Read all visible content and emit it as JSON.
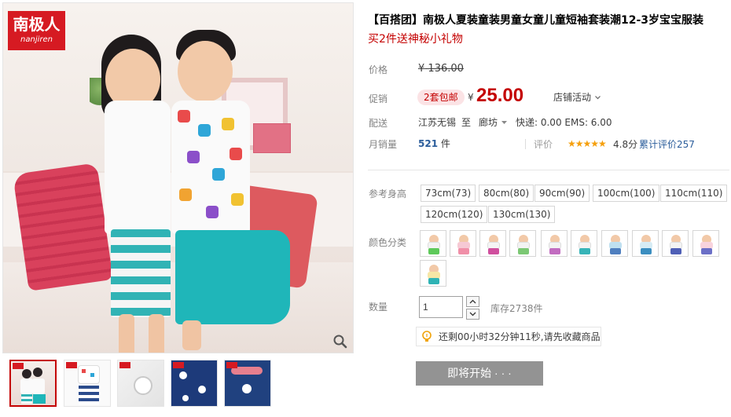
{
  "brand": {
    "name_cn": "南极人",
    "name_en": "nanjiren",
    "color": "#d61a22"
  },
  "gallery": {
    "zoom_icon": "zoom-in-icon",
    "thumb_count": 5
  },
  "product": {
    "title": "【百搭团】南极人夏装童装男童女童儿童短袖套装潮12-3岁宝宝服装",
    "subtitle": "买2件送神秘小礼物"
  },
  "price": {
    "label": "价格",
    "currency": "¥",
    "original": "136.00"
  },
  "promo": {
    "label": "促销",
    "tag": "2套包邮",
    "currency": "¥",
    "price": "25.00",
    "shop_activity": "店铺活动"
  },
  "shipping": {
    "label": "配送",
    "from": "江苏无锡",
    "to_word": "至",
    "to_city": "廊坊",
    "fee": "快递: 0.00 EMS: 6.00"
  },
  "sales": {
    "label": "月销量",
    "count": "521",
    "unit": "件",
    "rating_label": "评价",
    "stars": "★★★★★",
    "score": "4.8分",
    "review": "累计评价257"
  },
  "size": {
    "label": "参考身高",
    "options": [
      "73cm(73)",
      "80cm(80)",
      "90cm(90)",
      "100cm(100)",
      "110cm(110)",
      "120cm(120)",
      "130cm(130)"
    ]
  },
  "color": {
    "label": "颜色分类",
    "swatch_count": 11
  },
  "quantity": {
    "label": "数量",
    "value": "1",
    "stock": "库存2738件"
  },
  "tip": {
    "text": "还剩00小时32分钟11秒,请先收藏商品",
    "icon": "lightbulb-icon"
  },
  "action": {
    "button": "即将开始 · · ·"
  },
  "colors": {
    "accent": "#c40000",
    "link": "#2b5d9b",
    "star": "#f59f0a",
    "button_disabled": "#939393"
  }
}
